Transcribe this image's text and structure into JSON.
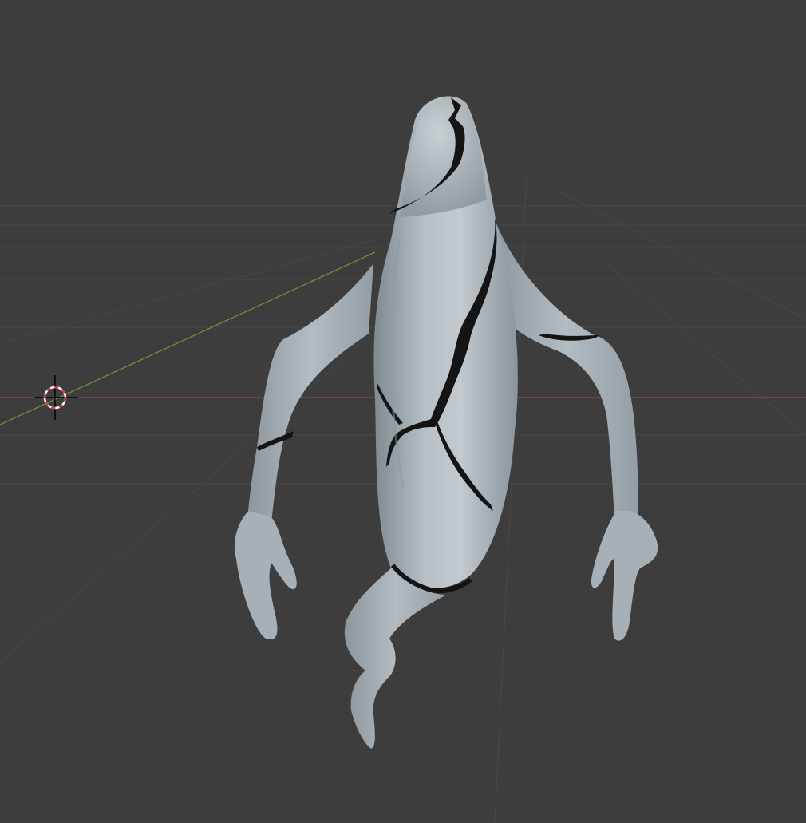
{
  "viewport": {
    "background_color": "#3d3d3d",
    "grid_color": "#464646",
    "x_axis_color": "#8f4a4f",
    "y_axis_color": "#6f8f3c"
  },
  "scene_object": {
    "kind": "sculpted-ghost-figure",
    "body_color": "#a9b3ba",
    "crack_color": "#141414"
  },
  "cursor": {
    "icon": "3d-cursor-icon"
  }
}
